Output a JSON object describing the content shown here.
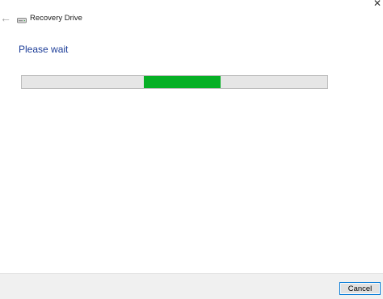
{
  "window": {
    "title": "Recovery Drive",
    "back_icon": "back-arrow-icon",
    "app_icon": "drive-icon",
    "close_icon": "close-icon"
  },
  "main": {
    "heading": "Please wait",
    "progress": {
      "mode": "indeterminate",
      "segment_start_fraction": 0.4,
      "segment_end_fraction": 0.65,
      "fill_color": "#06b025",
      "track_color": "#e6e6e6"
    }
  },
  "footer": {
    "cancel_label": "Cancel"
  },
  "colors": {
    "heading": "#1a3b97",
    "focus_border": "#0078d7",
    "footer_background": "#f0f0f0"
  },
  "icons": {
    "back": "←",
    "close": "✕"
  }
}
